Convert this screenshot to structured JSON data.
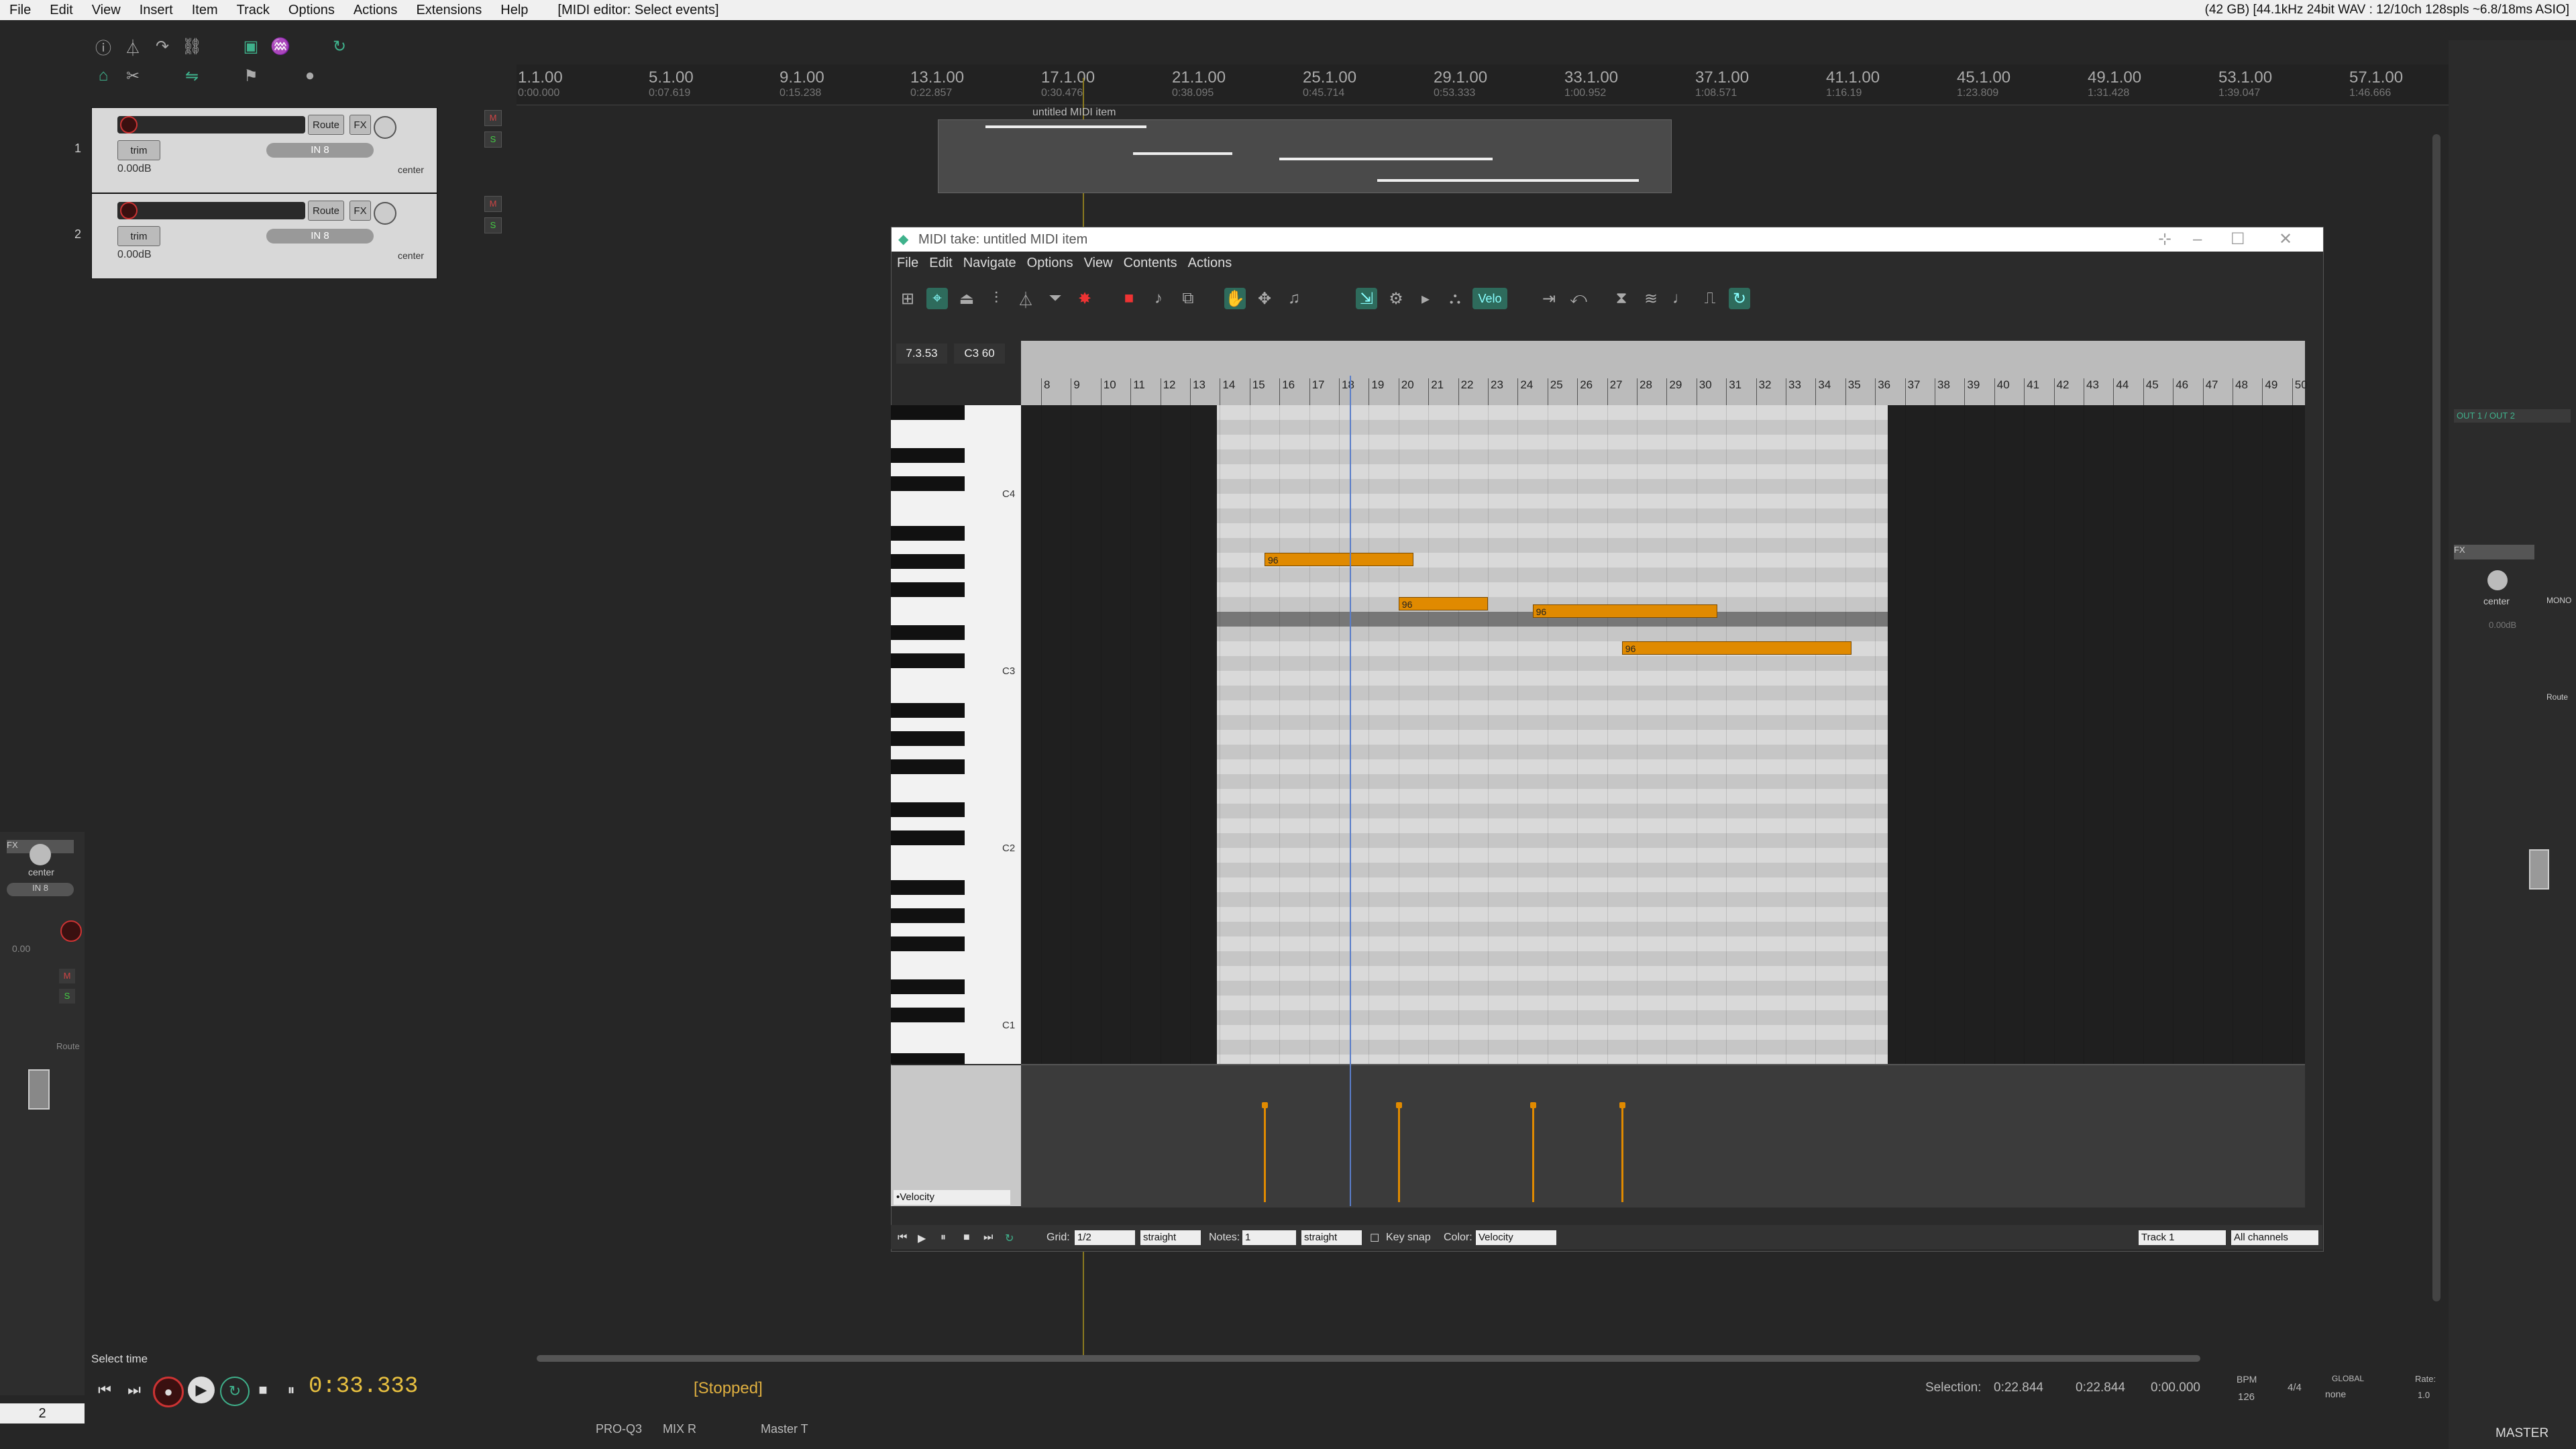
{
  "menubar": {
    "items": [
      "File",
      "Edit",
      "View",
      "Insert",
      "Item",
      "Track",
      "Options",
      "Actions",
      "Extensions",
      "Help"
    ],
    "window_title": "[MIDI editor: Select events]",
    "status": "(42 GB) [44.1kHz 24bit WAV : 12/10ch 128spls ~6.8/18ms ASIO]"
  },
  "tracks": [
    {
      "number": "1",
      "trim": "trim",
      "input": "IN 8",
      "volume": "0.00dB",
      "pan": "center",
      "route": "Route",
      "fx": "FX"
    },
    {
      "number": "2",
      "trim": "trim",
      "input": "IN 8",
      "volume": "0.00dB",
      "pan": "center",
      "route": "Route",
      "fx": "FX"
    }
  ],
  "ruler": {
    "marks": [
      {
        "bar": "1.1.00",
        "time": "0:00.000"
      },
      {
        "bar": "5.1.00",
        "time": "0:07.619"
      },
      {
        "bar": "9.1.00",
        "time": "0:15.238"
      },
      {
        "bar": "13.1.00",
        "time": "0:22.857"
      },
      {
        "bar": "17.1.00",
        "time": "0:30.476"
      },
      {
        "bar": "21.1.00",
        "time": "0:38.095"
      },
      {
        "bar": "25.1.00",
        "time": "0:45.714"
      },
      {
        "bar": "29.1.00",
        "time": "0:53.333"
      },
      {
        "bar": "33.1.00",
        "time": "1:00.952"
      },
      {
        "bar": "37.1.00",
        "time": "1:08.571"
      },
      {
        "bar": "41.1.00",
        "time": "1:16.19"
      },
      {
        "bar": "45.1.00",
        "time": "1:23.809"
      },
      {
        "bar": "49.1.00",
        "time": "1:31.428"
      },
      {
        "bar": "53.1.00",
        "time": "1:39.047"
      },
      {
        "bar": "57.1.00",
        "time": "1:46.666"
      }
    ]
  },
  "arrange_item": {
    "name": "untitled MIDI item"
  },
  "midi_editor": {
    "title": "MIDI take: untitled MIDI item",
    "menu": [
      "File",
      "Edit",
      "Navigate",
      "Options",
      "View",
      "Contents",
      "Actions"
    ],
    "velo_label": "Velo",
    "position": "7.3.53",
    "note_readout": "C3  60",
    "ruler_bars": [
      "8",
      "9",
      "10",
      "11",
      "12",
      "13",
      "14",
      "15",
      "16",
      "17",
      "18",
      "19",
      "20",
      "21",
      "22",
      "23",
      "24",
      "25",
      "26",
      "27",
      "28",
      "29",
      "30",
      "31",
      "32",
      "33",
      "34",
      "35",
      "36",
      "37",
      "38",
      "39",
      "40",
      "41",
      "42",
      "43",
      "44",
      "45",
      "46",
      "47",
      "48",
      "49",
      "50"
    ],
    "key_labels": [
      "C4",
      "C3",
      "C2",
      "C1"
    ],
    "notes": [
      {
        "label": "96",
        "start_bar": 15.5,
        "end_bar": 20.5,
        "row": 5
      },
      {
        "label": "96",
        "start_bar": 20.0,
        "end_bar": 23.0,
        "row": 8
      },
      {
        "label": "96",
        "start_bar": 24.5,
        "end_bar": 30.7,
        "row": 8.5
      },
      {
        "label": "96",
        "start_bar": 27.5,
        "end_bar": 35.2,
        "row": 11
      }
    ],
    "velocities": [
      {
        "bar": 15.5,
        "value": 96
      },
      {
        "bar": 20.0,
        "value": 96
      },
      {
        "bar": 24.5,
        "value": 96
      },
      {
        "bar": 27.5,
        "value": 96
      }
    ],
    "lane_selector": "•Velocity",
    "bottom": {
      "grid_label": "Grid:",
      "grid_value": "1/2",
      "grid_swing": "straight",
      "notes_label": "Notes:",
      "notes_value": "1",
      "notes_swing": "straight",
      "keysnap_label": "Key snap",
      "color_label": "Color:",
      "color_value": "Velocity",
      "track_value": "Track 1",
      "channel_value": "All channels"
    }
  },
  "transport": {
    "time": "0:33.333",
    "state": "[Stopped]",
    "select_label": "Select time",
    "page_number": "2"
  },
  "footer": {
    "selection_label": "Selection:",
    "sel_start": "0:22.844",
    "sel_end": "0:22.844",
    "sel_len": "0:00.000",
    "bpm_label": "BPM",
    "bpm": "126",
    "timesig": "4/4",
    "global_label": "GLOBAL",
    "global_value": "none",
    "rate_label": "Rate:",
    "rate": "1.0",
    "mixer_tabs": [
      "PRO-Q3",
      "MIX R",
      "Master T"
    ]
  },
  "master": {
    "label": "MASTER",
    "out": "OUT 1 / OUT 2",
    "pan": "center",
    "mono": "MONO",
    "volume": "0.00dB",
    "route": "Route",
    "fx": "FX"
  },
  "left_strip": {
    "pan": "center",
    "input": "IN 8",
    "volume": "0.00",
    "route": "Route",
    "fx": "FX"
  },
  "colors": {
    "note": "#e08a00",
    "accent": "#3fb28c",
    "time": "#e8c040"
  }
}
